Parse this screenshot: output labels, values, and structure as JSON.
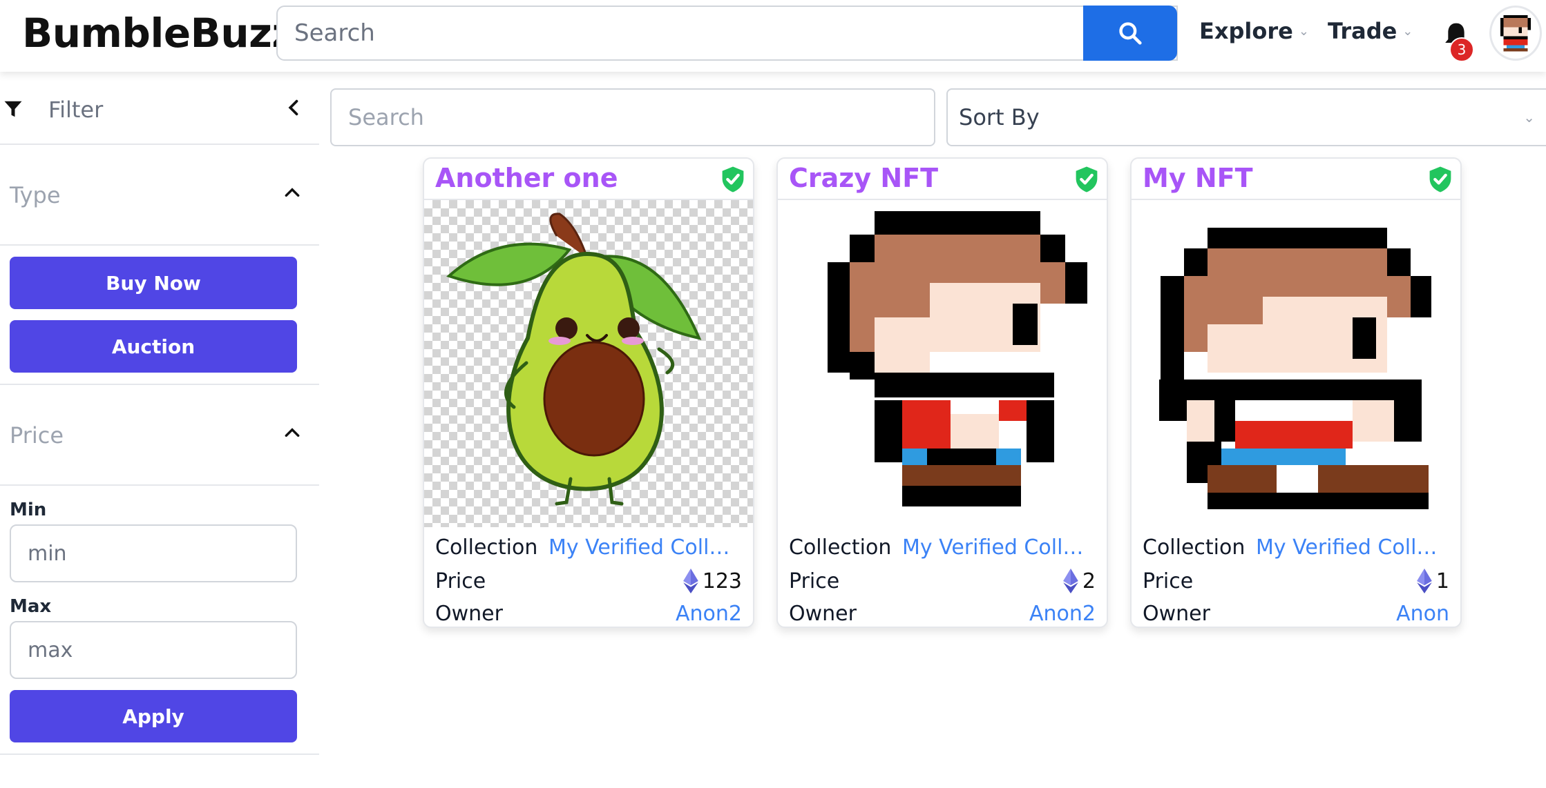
{
  "header": {
    "logo": "BumbleBuzz",
    "search_placeholder": "Search",
    "nav": [
      {
        "label": "Explore"
      },
      {
        "label": "Trade"
      }
    ],
    "notification_count": "3"
  },
  "sidebar": {
    "filter_label": "Filter",
    "type_title": "Type",
    "type_buttons": [
      {
        "label": "Buy Now"
      },
      {
        "label": "Auction"
      }
    ],
    "price_title": "Price",
    "min_label": "Min",
    "min_placeholder": "min",
    "max_label": "Max",
    "max_placeholder": "max",
    "apply_label": "Apply"
  },
  "toolbar": {
    "search_placeholder": "Search",
    "sort_label": "Sort By"
  },
  "labels": {
    "collection": "Collection",
    "price": "Price",
    "owner": "Owner"
  },
  "cards": [
    {
      "title": "Another one",
      "collection": "My Verified Collection",
      "price": "123",
      "owner": "Anon2",
      "image": "avocado-character"
    },
    {
      "title": "Crazy NFT",
      "collection": "My Verified Collection",
      "price": "2",
      "owner": "Anon2",
      "image": "pixel-character"
    },
    {
      "title": "My NFT",
      "collection": "My Verified Collection",
      "price": "1",
      "owner": "Anon",
      "image": "pixel-character"
    }
  ],
  "colors": {
    "primary_button": "#5046e5",
    "search_button": "#1e6ee6",
    "card_title": "#a855f7",
    "link": "#3b82f6",
    "verified": "#22c55e",
    "badge": "#dc2626"
  }
}
